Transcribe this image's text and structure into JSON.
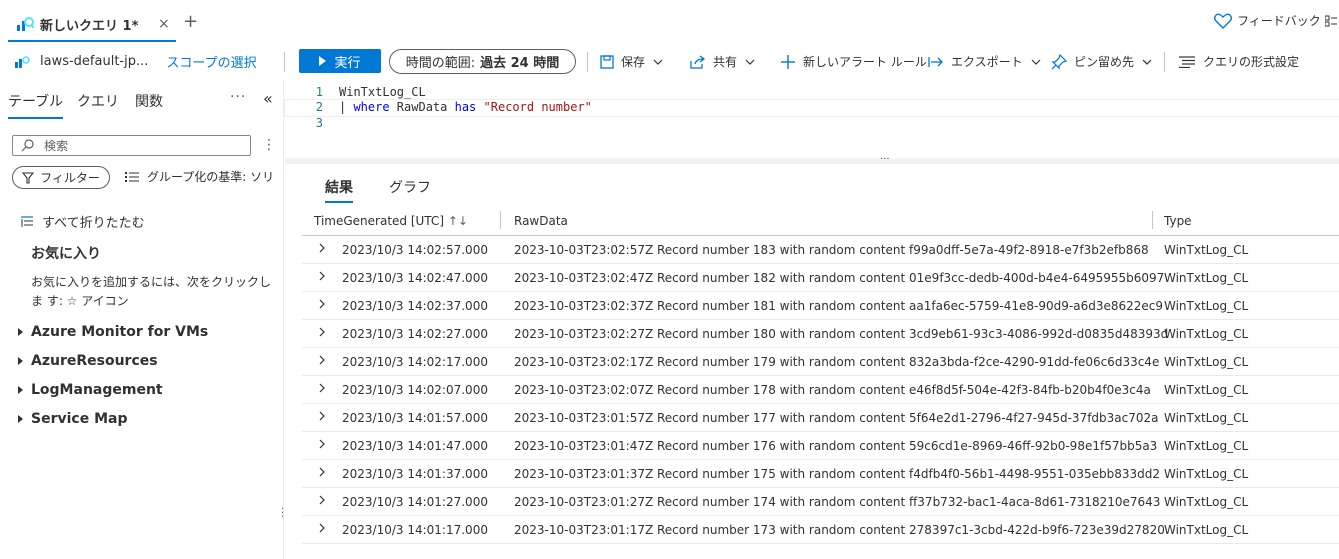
{
  "tab": {
    "title": "新しいクエリ 1*",
    "close": "×",
    "add": "+"
  },
  "header": {
    "feedback": "フィードバック"
  },
  "toolbar": {
    "scope_name": "laws-default-jp...",
    "scope_select": "スコープの選択",
    "run": "実行",
    "time_label": "時間の範囲:",
    "time_value": "過去 24 時間",
    "save": "保存",
    "share": "共有",
    "new_alert": "新しいアラート ルール",
    "export": "エクスポート",
    "pin": "ピン留め先",
    "format": "クエリの形式設定"
  },
  "sidebar": {
    "tabs": [
      "テーブル",
      "クエリ",
      "関数"
    ],
    "more": "···",
    "collapse": "«",
    "search_placeholder": "検索",
    "filter": "フィルター",
    "group_by": "グループ化の基準: ソリュ-",
    "collapse_all": "すべて折りたたむ",
    "favorites_title": "お気に入り",
    "favorites_help": "お気に入りを追加するには、次をクリックしま す: ☆ アイコン",
    "tree": [
      "Azure Monitor for VMs",
      "AzureResources",
      "LogManagement",
      "Service Map"
    ]
  },
  "editor": {
    "lines": [
      {
        "num": "1",
        "table": "WinTxtLog_CL"
      },
      {
        "num": "2",
        "pipe": "| ",
        "kw1": "where",
        "field": " RawData ",
        "kw2": "has",
        "sp": " ",
        "str": "\"Record number\""
      },
      {
        "num": "3"
      }
    ]
  },
  "results": {
    "tabs": [
      "結果",
      "グラフ"
    ],
    "columns": [
      "TimeGenerated [UTC]",
      "RawData",
      "Type"
    ],
    "sort_icon": "↑↓",
    "rows": [
      [
        "2023/10/3 14:02:57.000",
        "2023-10-03T23:02:57Z Record number 183 with random content f99a0dff-5e7a-49f2-8918-e7f3b2efb868",
        "WinTxtLog_CL"
      ],
      [
        "2023/10/3 14:02:47.000",
        "2023-10-03T23:02:47Z Record number 182 with random content 01e9f3cc-dedb-400d-b4e4-6495955b6097",
        "WinTxtLog_CL"
      ],
      [
        "2023/10/3 14:02:37.000",
        "2023-10-03T23:02:37Z Record number 181 with random content aa1fa6ec-5759-41e8-90d9-a6d3e8622ec9",
        "WinTxtLog_CL"
      ],
      [
        "2023/10/3 14:02:27.000",
        "2023-10-03T23:02:27Z Record number 180 with random content 3cd9eb61-93c3-4086-992d-d0835d48393d",
        "WinTxtLog_CL"
      ],
      [
        "2023/10/3 14:02:17.000",
        "2023-10-03T23:02:17Z Record number 179 with random content 832a3bda-f2ce-4290-91dd-fe06c6d33c4e",
        "WinTxtLog_CL"
      ],
      [
        "2023/10/3 14:02:07.000",
        "2023-10-03T23:02:07Z Record number 178 with random content e46f8d5f-504e-42f3-84fb-b20b4f0e3c4a",
        "WinTxtLog_CL"
      ],
      [
        "2023/10/3 14:01:57.000",
        "2023-10-03T23:01:57Z Record number 177 with random content 5f64e2d1-2796-4f27-945d-37fdb3ac702a",
        "WinTxtLog_CL"
      ],
      [
        "2023/10/3 14:01:47.000",
        "2023-10-03T23:01:47Z Record number 176 with random content 59c6cd1e-8969-46ff-92b0-98e1f57bb5a3",
        "WinTxtLog_CL"
      ],
      [
        "2023/10/3 14:01:37.000",
        "2023-10-03T23:01:37Z Record number 175 with random content f4dfb4f0-56b1-4498-9551-035ebb833dd2",
        "WinTxtLog_CL"
      ],
      [
        "2023/10/3 14:01:27.000",
        "2023-10-03T23:01:27Z Record number 174 with random content ff37b732-bac1-4aca-8d61-7318210e7643",
        "WinTxtLog_CL"
      ],
      [
        "2023/10/3 14:01:17.000",
        "2023-10-03T23:01:17Z Record number 173 with random content 278397c1-3cbd-422d-b9f6-723e39d27820",
        "WinTxtLog_CL"
      ]
    ]
  },
  "colors": {
    "accent": "#0078d4",
    "text": "#323130",
    "keyword": "#0000ff",
    "string": "#a31515",
    "line_number": "#237893"
  }
}
